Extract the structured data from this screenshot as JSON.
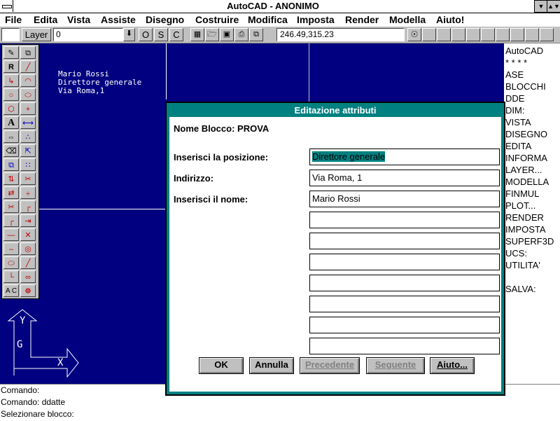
{
  "window": {
    "title": "AutoCAD - ANONIMO"
  },
  "menu": {
    "items": [
      "File",
      "Edita",
      "Vista",
      "Assiste",
      "Disegno",
      "Costruire",
      "Modifica",
      "Imposta",
      "Render",
      "Modella",
      "Aiuto!"
    ]
  },
  "toolbar": {
    "layer_button": "Layer",
    "layer_value": "0",
    "ortho": "O",
    "snap": "S",
    "coords_toggle": "C",
    "coordinates": "246.49,315.23"
  },
  "drawing": {
    "attribute_lines": [
      "Mario Rossi",
      "Direttore generale",
      "Via Roma,1"
    ],
    "ucs_labels": {
      "y": "Y",
      "x": "X",
      "g": "G"
    }
  },
  "toolbox": {
    "icons": [
      "pencil-icon",
      "layers-icon",
      "redraw-icon",
      "line-icon",
      "polyline-icon",
      "arc-icon",
      "circle-icon",
      "ellipse-icon",
      "polygon-icon",
      "point-icon",
      "text-icon",
      "dimension-icon",
      "stretch-icon",
      "array-icon",
      "erase-icon",
      "scale-icon",
      "copy-icon",
      "grid-icon",
      "mirror-icon",
      "trim-icon",
      "offset-icon",
      "fillet-icon",
      "break-icon",
      "chamfer-icon",
      "fillet2-icon",
      "extend-icon",
      "hline-icon",
      "cross-icon",
      "dash-icon",
      "donut-icon",
      "ellipse2-icon",
      "divide-icon",
      "corner-icon",
      "join-icon",
      "text-style-icon",
      "hatch-icon"
    ],
    "text_r": "R",
    "text_a": "A",
    "text_ac": "A C"
  },
  "sidemenu": {
    "items": [
      "AutoCAD",
      "* * * *",
      "ASE",
      "BLOCCHI",
      "DDE",
      "DIM:",
      "VISTA",
      "DISEGNO",
      "EDITA",
      "INFORMA",
      "LAYER...",
      "MODELLA",
      "FINMUL",
      "PLOT...",
      "RENDER",
      "IMPOSTA",
      "SUPERF3D",
      "UCS:",
      "UTILITA'",
      "",
      "SALVA:"
    ]
  },
  "command": {
    "lines": [
      "Comando:",
      "Comando: ddatte",
      "Selezionare blocco:"
    ]
  },
  "dialog": {
    "title": "Editazione attributi",
    "block_name_label": "Nome Blocco:",
    "block_name_value": "PROVA",
    "fields": [
      {
        "label": "Inserisci la posizione:",
        "value": "Direttore generale"
      },
      {
        "label": "Indirizzo:",
        "value": "Via Roma, 1"
      },
      {
        "label": "Inserisci il nome:",
        "value": "Mario Rossi"
      },
      {
        "label": "",
        "value": ""
      },
      {
        "label": "",
        "value": ""
      },
      {
        "label": "",
        "value": ""
      },
      {
        "label": "",
        "value": ""
      },
      {
        "label": "",
        "value": ""
      },
      {
        "label": "",
        "value": ""
      },
      {
        "label": "",
        "value": ""
      }
    ],
    "buttons": {
      "ok": "OK",
      "cancel": "Annulla",
      "previous": "Precedente",
      "next": "Seguente",
      "help": "Aiuto..."
    }
  },
  "colors": {
    "drawing_bg": "#000080",
    "dialog_accent": "#008080",
    "window_face": "#c0c0c0"
  }
}
